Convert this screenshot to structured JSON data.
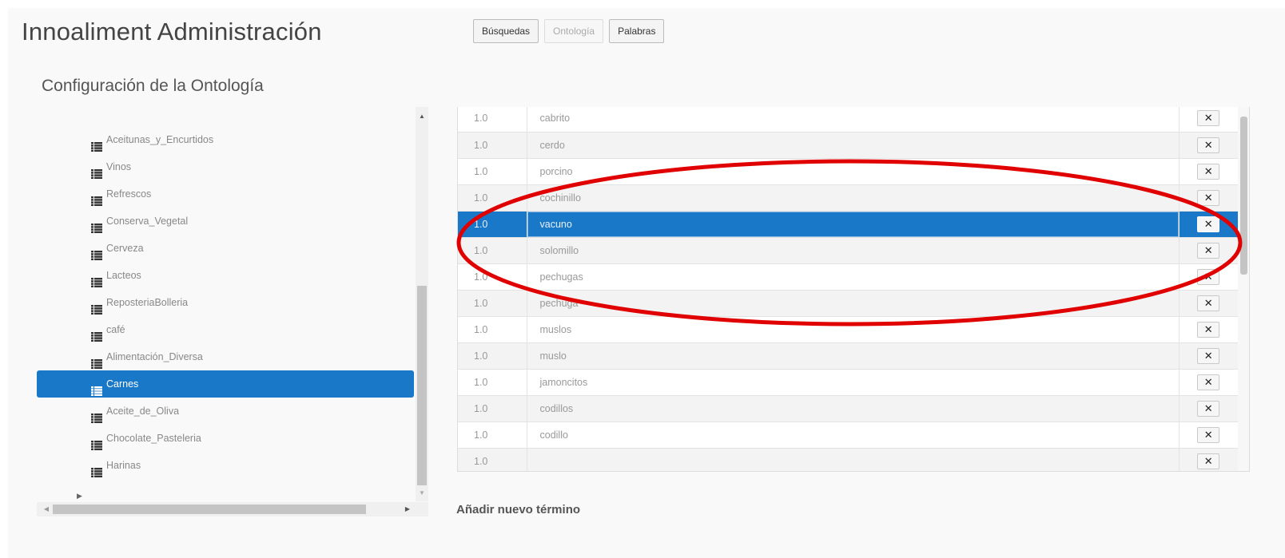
{
  "header": {
    "app_title": "Innoaliment Administración",
    "nav": [
      {
        "label": "Búsquedas",
        "enabled": true
      },
      {
        "label": "Ontología",
        "enabled": false
      },
      {
        "label": "Palabras",
        "enabled": true
      }
    ]
  },
  "section_title": "Configuración de la Ontología",
  "tree": {
    "item_icon": "list-icon",
    "expander_icon": "caret-right-icon",
    "selected_index": 9,
    "items": [
      {
        "label": "Aceitunas_y_Encurtidos"
      },
      {
        "label": "Vinos"
      },
      {
        "label": "Refrescos"
      },
      {
        "label": "Conserva_Vegetal"
      },
      {
        "label": "Cerveza"
      },
      {
        "label": "Lacteos"
      },
      {
        "label": "ReposteriaBolleria"
      },
      {
        "label": "café"
      },
      {
        "label": "Alimentación_Diversa"
      },
      {
        "label": "Carnes"
      },
      {
        "label": "Aceite_de_Oliva"
      },
      {
        "label": "Chocolate_Pasteleria"
      },
      {
        "label": "Harinas"
      }
    ]
  },
  "terms": {
    "delete_icon": "close-icon",
    "delete_label": "✕",
    "selected_index": 4,
    "rows": [
      {
        "weight": "1.0",
        "term": "cabrito"
      },
      {
        "weight": "1.0",
        "term": "cerdo"
      },
      {
        "weight": "1.0",
        "term": "porcino"
      },
      {
        "weight": "1.0",
        "term": "cochinillo"
      },
      {
        "weight": "1.0",
        "term": "vacuno"
      },
      {
        "weight": "1.0",
        "term": "solomillo"
      },
      {
        "weight": "1.0",
        "term": "pechugas"
      },
      {
        "weight": "1.0",
        "term": "pechuga"
      },
      {
        "weight": "1.0",
        "term": "muslos"
      },
      {
        "weight": "1.0",
        "term": "muslo"
      },
      {
        "weight": "1.0",
        "term": "jamoncitos"
      },
      {
        "weight": "1.0",
        "term": "codillos"
      },
      {
        "weight": "1.0",
        "term": "codillo"
      },
      {
        "weight": "1.0",
        "term": ""
      }
    ]
  },
  "add_term_label": "Añadir nuevo término",
  "colors": {
    "selection": "#1a78c9",
    "annotation": "#e00000"
  }
}
